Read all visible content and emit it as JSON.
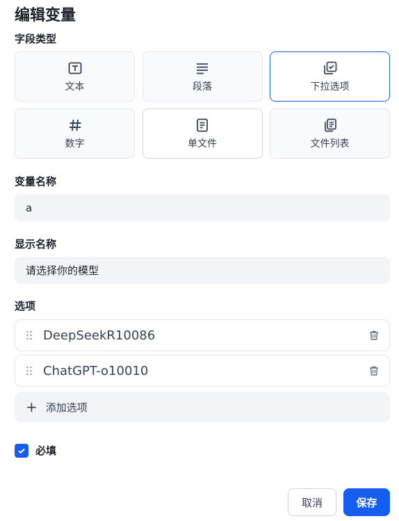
{
  "dialog": {
    "title": "编辑变量"
  },
  "field_type": {
    "label": "字段类型",
    "options": [
      {
        "label": "文本",
        "icon": "text-box-icon"
      },
      {
        "label": "段落",
        "icon": "paragraph-lines-icon"
      },
      {
        "label": "下拉选项",
        "icon": "dropdown-check-icon",
        "selected": true
      },
      {
        "label": "数字",
        "icon": "hash-icon"
      },
      {
        "label": "单文件",
        "icon": "file-icon"
      },
      {
        "label": "文件列表",
        "icon": "file-list-icon"
      }
    ]
  },
  "variable_name": {
    "label": "变量名称",
    "value": "a"
  },
  "display_name": {
    "label": "显示名称",
    "value": "请选择你的模型"
  },
  "options": {
    "label": "选项",
    "items": [
      "DeepSeekR10086",
      "ChatGPT-o10010"
    ],
    "add_label": "添加选项"
  },
  "required": {
    "label": "必填",
    "checked": true
  },
  "actions": {
    "cancel": "取消",
    "save": "保存"
  },
  "colors": {
    "accent": "#155eef",
    "input_bg": "#f2f4f7",
    "border": "#e5e6eb"
  }
}
